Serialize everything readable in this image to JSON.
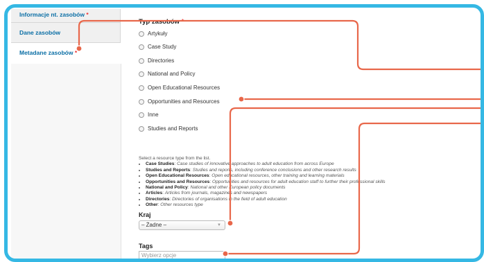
{
  "sidebar": {
    "tabs": [
      {
        "label": "Informacje nt. zasobów",
        "required": "*"
      },
      {
        "label": "Dane zasobów"
      },
      {
        "label": "Metadane zasobów",
        "required": "*"
      }
    ]
  },
  "resource_type": {
    "title": "Typ zasobów",
    "required": "*",
    "options": [
      "Artykuły",
      "Case Study",
      "Directories",
      "National and Policy",
      "Open Educational Resources",
      "Opportunities and Resources",
      "Inne",
      "Studies and Reports"
    ],
    "help_intro": "Select a resource type from the list.",
    "help_items": [
      {
        "term": "Case Studies",
        "text": "Case studies of innovative approaches to adult education from across Europe"
      },
      {
        "term": "Studies and Reports",
        "text": "Studies and reports, including conference conclusions and other research results"
      },
      {
        "term": "Open Educational Resources",
        "text": "Open educational resources, other training and learning materials"
      },
      {
        "term": "Opportunities and Resources",
        "text": "Opportunities and resources for adult education staff to further their professional skills"
      },
      {
        "term": "National and Policy",
        "text": "National and other European policy documents"
      },
      {
        "term": "Articles",
        "text": "Articles from journals, magazines and newspapers"
      },
      {
        "term": "Directories",
        "text": "Directories of organisations in the field of adult education"
      },
      {
        "term": "Other",
        "text": "Other resources type"
      }
    ]
  },
  "country": {
    "label": "Kraj",
    "selected": "– Żadne –"
  },
  "tags": {
    "label": "Tags",
    "placeholder": "Wybierz opcje"
  },
  "colors": {
    "frame": "#35b8e4",
    "annotation": "#e8674a",
    "link": "#0a6ea5"
  }
}
